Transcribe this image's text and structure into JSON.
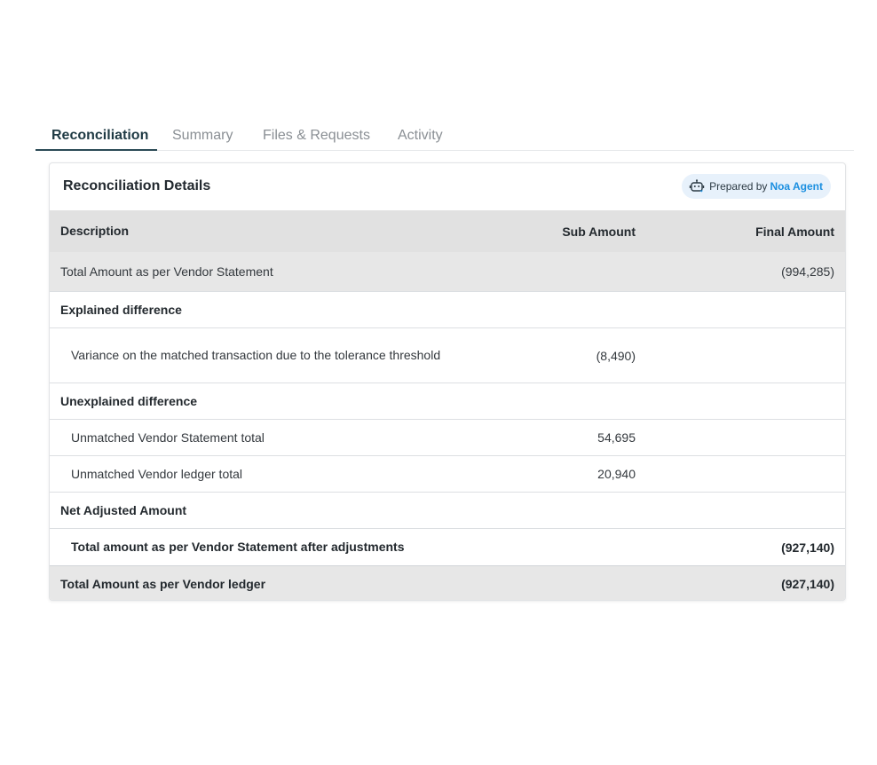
{
  "tabs": [
    {
      "label": "Reconciliation",
      "active": true
    },
    {
      "label": "Summary",
      "active": false
    },
    {
      "label": "Files & Requests",
      "active": false
    },
    {
      "label": "Activity",
      "active": false
    }
  ],
  "card": {
    "title": "Reconciliation Details",
    "badge": {
      "prefix": "Prepared by",
      "agent": "Noa Agent",
      "icon": "robot-icon"
    }
  },
  "table": {
    "headers": {
      "description": "Description",
      "sub_amount": "Sub Amount",
      "final_amount": "Final Amount"
    },
    "rows": [
      {
        "description": "Total Amount as per Vendor Statement",
        "sub": "",
        "final": "(994,285)"
      },
      {
        "description": "Explained difference",
        "sub": "",
        "final": ""
      },
      {
        "description": "Variance on the matched transaction due to the tolerance threshold",
        "sub": "(8,490)",
        "final": ""
      },
      {
        "description": "Unexplained difference",
        "sub": "",
        "final": ""
      },
      {
        "description": "Unmatched Vendor Statement total",
        "sub": "54,695",
        "final": ""
      },
      {
        "description": "Unmatched Vendor ledger total",
        "sub": "20,940",
        "final": ""
      },
      {
        "description": "Net Adjusted Amount",
        "sub": "",
        "final": ""
      },
      {
        "description": "Total amount as per Vendor Statement after adjustments",
        "sub": "",
        "final": "(927,140)"
      },
      {
        "description": "Total Amount as per Vendor ledger",
        "sub": "",
        "final": "(927,140)"
      }
    ]
  },
  "colors": {
    "accent": "#1b8fe0",
    "header_bg": "#e1e1e1",
    "active_tab": "#1f3a44"
  }
}
